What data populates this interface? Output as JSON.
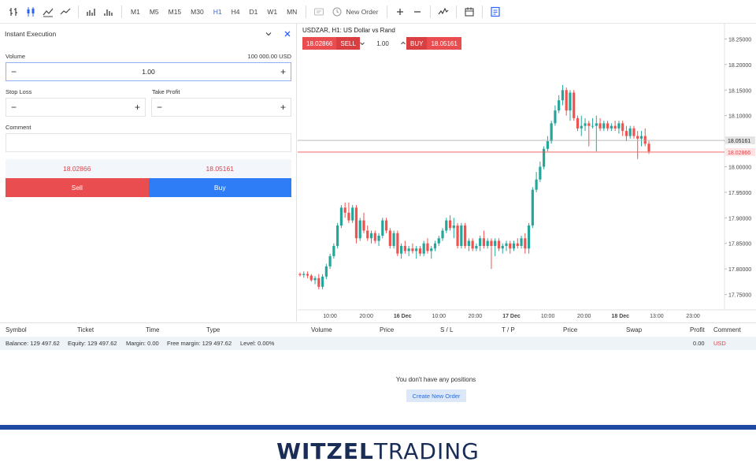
{
  "toolbar": {
    "timeframes": [
      "M1",
      "M5",
      "M15",
      "M30",
      "H1",
      "H4",
      "D1",
      "W1",
      "MN"
    ],
    "active_timeframe": "H1",
    "new_order_label": "New Order"
  },
  "order_panel": {
    "title": "Instant Execution",
    "volume_label": "Volume",
    "volume_hint": "100 000.00 USD",
    "volume_value": "1.00",
    "stop_loss_label": "Stop Loss",
    "take_profit_label": "Take Profit",
    "comment_label": "Comment",
    "bid_price": "18.02866",
    "ask_price": "18.05161",
    "sell_label": "Sell",
    "buy_label": "Buy"
  },
  "chart": {
    "title": "USDZAR, H1: US Dollar vs Rand",
    "quick_trade": {
      "sell_price": "18.02866",
      "sell_label": "SELL",
      "volume": "1.00",
      "buy_label": "BUY",
      "buy_price": "18.05161"
    },
    "colors": {
      "up": "#26a69a",
      "down": "#ef5350",
      "bid_line": "#ef5350",
      "ask_line": "#b0b0b0"
    }
  },
  "chart_data": {
    "type": "candlestick",
    "symbol": "USDZAR",
    "timeframe": "H1",
    "ylim": [
      17.72,
      18.28
    ],
    "y_ticks": [
      "18.25000",
      "18.20000",
      "18.15000",
      "18.10000",
      "18.05000",
      "18.00000",
      "17.95000",
      "17.90000",
      "17.85000",
      "17.80000",
      "17.75000"
    ],
    "y_tick_values": [
      18.25,
      18.2,
      18.15,
      18.1,
      18.05,
      18.0,
      17.95,
      17.9,
      17.85,
      17.8,
      17.75
    ],
    "x_ticks": [
      "10:00",
      "20:00",
      "16 Dec",
      "10:00",
      "20:00",
      "17 Dec",
      "10:00",
      "20:00",
      "18 Dec",
      "13:00",
      "23:00"
    ],
    "bid_label": "18.02866",
    "ask_label": "18.05161",
    "bid": 18.02866,
    "ask": 18.05161,
    "candles": [
      [
        17.79,
        17.793,
        17.785,
        17.788
      ],
      [
        17.788,
        17.795,
        17.783,
        17.79
      ],
      [
        17.79,
        17.795,
        17.782,
        17.787
      ],
      [
        17.787,
        17.79,
        17.775,
        17.778
      ],
      [
        17.778,
        17.786,
        17.77,
        17.782
      ],
      [
        17.782,
        17.79,
        17.76,
        17.765
      ],
      [
        17.765,
        17.79,
        17.76,
        17.785
      ],
      [
        17.785,
        17.81,
        17.78,
        17.805
      ],
      [
        17.805,
        17.83,
        17.8,
        17.825
      ],
      [
        17.825,
        17.85,
        17.82,
        17.845
      ],
      [
        17.845,
        17.89,
        17.84,
        17.885
      ],
      [
        17.885,
        17.925,
        17.88,
        17.92
      ],
      [
        17.92,
        17.93,
        17.9,
        17.91
      ],
      [
        17.91,
        17.93,
        17.89,
        17.895
      ],
      [
        17.895,
        17.925,
        17.89,
        17.92
      ],
      [
        17.92,
        17.925,
        17.85,
        17.86
      ],
      [
        17.86,
        17.9,
        17.855,
        17.895
      ],
      [
        17.895,
        17.91,
        17.87,
        17.875
      ],
      [
        17.875,
        17.885,
        17.855,
        17.86
      ],
      [
        17.86,
        17.875,
        17.85,
        17.87
      ],
      [
        17.87,
        17.875,
        17.85,
        17.855
      ],
      [
        17.855,
        17.87,
        17.845,
        17.865
      ],
      [
        17.865,
        17.9,
        17.86,
        17.895
      ],
      [
        17.895,
        17.9,
        17.87,
        17.875
      ],
      [
        17.875,
        17.88,
        17.84,
        17.845
      ],
      [
        17.845,
        17.875,
        17.84,
        17.87
      ],
      [
        17.87,
        17.875,
        17.825,
        17.83
      ],
      [
        17.83,
        17.85,
        17.82,
        17.845
      ],
      [
        17.845,
        17.855,
        17.83,
        17.835
      ],
      [
        17.835,
        17.845,
        17.825,
        17.84
      ],
      [
        17.84,
        17.85,
        17.83,
        17.835
      ],
      [
        17.835,
        17.845,
        17.82,
        17.84
      ],
      [
        17.84,
        17.845,
        17.825,
        17.83
      ],
      [
        17.83,
        17.855,
        17.825,
        17.85
      ],
      [
        17.85,
        17.86,
        17.83,
        17.835
      ],
      [
        17.835,
        17.845,
        17.82,
        17.84
      ],
      [
        17.84,
        17.855,
        17.835,
        17.85
      ],
      [
        17.85,
        17.865,
        17.845,
        17.86
      ],
      [
        17.86,
        17.88,
        17.855,
        17.875
      ],
      [
        17.875,
        17.9,
        17.87,
        17.895
      ],
      [
        17.895,
        17.905,
        17.875,
        17.88
      ],
      [
        17.88,
        17.9,
        17.86,
        17.885
      ],
      [
        17.885,
        17.89,
        17.84,
        17.845
      ],
      [
        17.845,
        17.89,
        17.84,
        17.885
      ],
      [
        17.885,
        17.89,
        17.84,
        17.845
      ],
      [
        17.845,
        17.86,
        17.835,
        17.855
      ],
      [
        17.855,
        17.86,
        17.835,
        17.84
      ],
      [
        17.84,
        17.85,
        17.835,
        17.845
      ],
      [
        17.845,
        17.865,
        17.835,
        17.86
      ],
      [
        17.86,
        17.875,
        17.84,
        17.845
      ],
      [
        17.845,
        17.86,
        17.84,
        17.855
      ],
      [
        17.855,
        17.86,
        17.8,
        17.845
      ],
      [
        17.845,
        17.86,
        17.825,
        17.855
      ],
      [
        17.855,
        17.86,
        17.835,
        17.84
      ],
      [
        17.84,
        17.85,
        17.83,
        17.845
      ],
      [
        17.845,
        17.855,
        17.835,
        17.85
      ],
      [
        17.85,
        17.855,
        17.83,
        17.84
      ],
      [
        17.84,
        17.855,
        17.835,
        17.85
      ],
      [
        17.85,
        17.86,
        17.84,
        17.845
      ],
      [
        17.845,
        17.865,
        17.84,
        17.86
      ],
      [
        17.86,
        17.87,
        17.83,
        17.84
      ],
      [
        17.84,
        17.89,
        17.83,
        17.885
      ],
      [
        17.885,
        17.96,
        17.88,
        17.955
      ],
      [
        17.955,
        17.99,
        17.95,
        17.975
      ],
      [
        17.975,
        18.01,
        17.97,
        18.0
      ],
      [
        18.0,
        18.04,
        17.995,
        18.035
      ],
      [
        18.035,
        18.06,
        18.03,
        18.05
      ],
      [
        18.05,
        18.09,
        18.045,
        18.085
      ],
      [
        18.085,
        18.12,
        18.08,
        18.11
      ],
      [
        18.11,
        18.14,
        18.105,
        18.13
      ],
      [
        18.13,
        18.16,
        18.12,
        18.15
      ],
      [
        18.15,
        18.155,
        18.1,
        18.11
      ],
      [
        18.11,
        18.15,
        18.09,
        18.145
      ],
      [
        18.145,
        18.15,
        18.09,
        18.095
      ],
      [
        18.095,
        18.1,
        18.07,
        18.075
      ],
      [
        18.075,
        18.1,
        18.06,
        18.08
      ],
      [
        18.08,
        18.095,
        18.07,
        18.085
      ],
      [
        18.085,
        18.09,
        18.04,
        18.08
      ],
      [
        18.08,
        18.095,
        18.075,
        18.08
      ],
      [
        18.08,
        18.1,
        18.03,
        18.085
      ],
      [
        18.085,
        18.095,
        18.07,
        18.075
      ],
      [
        18.075,
        18.09,
        18.07,
        18.085
      ],
      [
        18.085,
        18.09,
        18.07,
        18.075
      ],
      [
        18.075,
        18.085,
        18.07,
        18.08
      ],
      [
        18.08,
        18.09,
        18.07,
        18.075
      ],
      [
        18.075,
        18.09,
        18.065,
        18.085
      ],
      [
        18.085,
        18.09,
        18.06,
        18.07
      ],
      [
        18.07,
        18.08,
        18.05,
        18.06
      ],
      [
        18.06,
        18.08,
        18.055,
        18.075
      ],
      [
        18.075,
        18.08,
        18.055,
        18.06
      ],
      [
        18.06,
        18.07,
        18.015,
        18.055
      ],
      [
        18.055,
        18.07,
        18.04,
        18.06
      ],
      [
        18.06,
        18.075,
        18.04,
        18.045
      ],
      [
        18.045,
        18.05,
        18.025,
        18.03
      ]
    ]
  },
  "positions": {
    "columns": [
      "Symbol",
      "Ticket",
      "Time",
      "Type",
      "Volume",
      "Price",
      "S / L",
      "T / P",
      "Price",
      "Swap",
      "Profit",
      "Comment"
    ],
    "balance": "Balance: 129 497.62",
    "equity": "Equity: 129 497.62",
    "margin": "Margin: 0.00",
    "free_margin": "Free margin: 129 497.62",
    "level": "Level: 0.00%",
    "profit_total": "0.00",
    "currency": "USD",
    "empty_message": "You don't have any positions",
    "create_order_label": "Create New Order"
  },
  "footer": {
    "logo_part1": "WITZEL",
    "logo_part2": "TRADING"
  }
}
